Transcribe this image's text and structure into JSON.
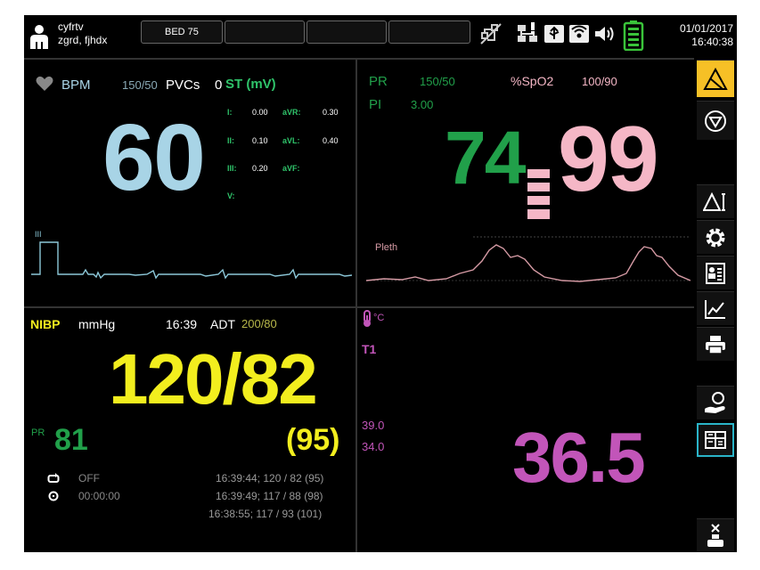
{
  "patient": {
    "line1": "cyfrtv",
    "line2": "zgrd, fjhdx"
  },
  "bed_tabs": [
    "BED 75",
    "",
    "",
    ""
  ],
  "datetime": {
    "date": "01/01/2017",
    "time": "16:40:38"
  },
  "ecg": {
    "bpm_label": "BPM",
    "alarm_limits": "150/50",
    "pvcs_label": "PVCs",
    "pvcs_value": "0",
    "st_label": "ST (mV)",
    "hr_value": "60",
    "lead_label": "III",
    "st_values": [
      {
        "lead": "I:",
        "value": "0.00"
      },
      {
        "lead": "aVR:",
        "value": "0.30"
      },
      {
        "lead": "II:",
        "value": "0.10"
      },
      {
        "lead": "aVL:",
        "value": "0.40"
      },
      {
        "lead": "III:",
        "value": "0.20"
      },
      {
        "lead": "aVF:",
        "value": ""
      },
      {
        "lead": "V:",
        "value": ""
      }
    ]
  },
  "spo2": {
    "pr_label": "PR",
    "pr_limits": "150/50",
    "spo2_label": "%SpO2",
    "spo2_limits": "100/90",
    "pi_label": "PI",
    "pi_value": "3.00",
    "pr_value": "74",
    "spo2_value": "99",
    "pleth_label": "Pleth"
  },
  "nibp": {
    "label": "NIBP",
    "unit": "mmHg",
    "time": "16:39",
    "adt_label": "ADT",
    "adt_value": "200/80",
    "value": "120/82",
    "pr_label": "PR",
    "pr_value": "81",
    "mean": "(95)",
    "cycle_status": "OFF",
    "timer": "00:00:00",
    "history": [
      "16:39:44; 120 / 82 (95)",
      "16:39:49; 117 / 88 (98)",
      "16:38:55; 117 / 93 (101)"
    ]
  },
  "temp": {
    "unit": "°C",
    "channel": "T1",
    "upper_limit": "39.0",
    "lower_limit": "34.0",
    "value": "36.5"
  },
  "colors": {
    "hr": "#a8d4e6",
    "pr": "#21a04a",
    "spo2": "#f5b7c6",
    "nibp": "#f2ee1e",
    "temp": "#c255b9",
    "ecg_wave": "#8cc7d8",
    "pleth_wave": "#d59aa4",
    "alarm": "#f6c026",
    "st_header": "#2fc36a"
  },
  "sidebar_icons": [
    "alarm-bell-icon",
    "silence-icon",
    "alarm-setup-icon",
    "settings-gear-icon",
    "patient-info-icon",
    "trends-chart-icon",
    "printer-icon",
    "review-hand-icon",
    "layout-screen-icon",
    "standby-icon"
  ]
}
